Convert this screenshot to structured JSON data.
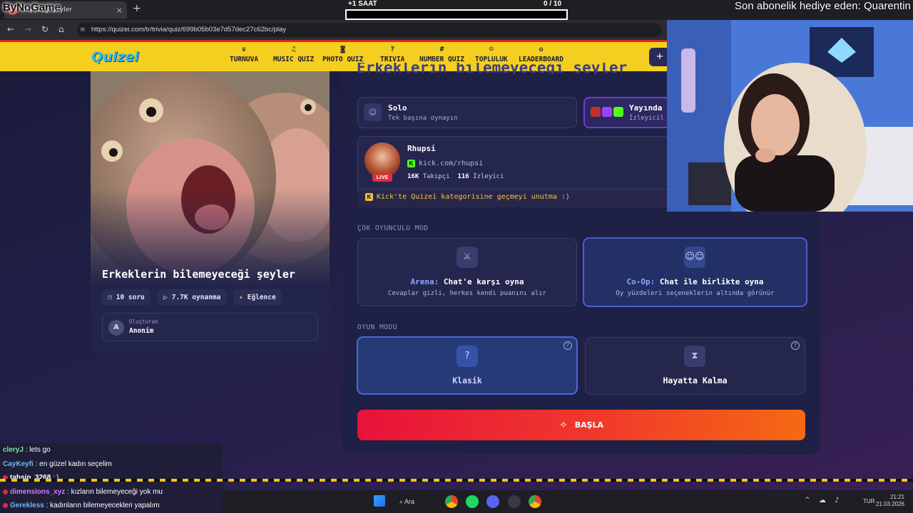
{
  "browser": {
    "tab_title": "neyeceği şeyler",
    "url": "https://quizei.com/tr/trivia/quiz/699b05b03e7d57dec27c62bc/play",
    "new_tab_label": "+",
    "close_tab_label": "×"
  },
  "overlay": {
    "channel_logo_text": "ByNoGame",
    "timer_label": "+1 SAAT",
    "timer_count": "0  / 10",
    "timer_progress": 0,
    "sub_gift_text": "Son abonelik hediye eden: Quarentin"
  },
  "site": {
    "logo": "Quizei",
    "nav": [
      {
        "label": "TURNUVA",
        "icon": "trophy-icon",
        "glyph": "♛"
      },
      {
        "label": "MUSIC QUIZ",
        "icon": "music-icon",
        "glyph": "♫"
      },
      {
        "label": "PHOTO QUIZ",
        "icon": "camera-icon",
        "glyph": "◙"
      },
      {
        "label": "TRIVIA",
        "icon": "question-bubble-icon",
        "glyph": "?"
      },
      {
        "label": "NUMBER QUIZ",
        "icon": "hash-icon",
        "glyph": "#"
      },
      {
        "label": "TOPLULUK",
        "icon": "users-icon",
        "glyph": "☺"
      },
      {
        "label": "LEADERBOARD",
        "icon": "medal-icon",
        "glyph": "✪"
      }
    ],
    "plus_label": "+"
  },
  "quiz": {
    "title": "Erkeklerin bilemeyeceği şeyler",
    "heading": "Erkeklerin bilemeyeceği şeyler",
    "question_count": "10 soru",
    "plays": "7.7K oynanma",
    "category": "Eğlence",
    "creator_role": "Oluşturan",
    "creator_name": "Anonim",
    "creator_initial": "A"
  },
  "modes": {
    "solo_title": "Solo",
    "solo_sub": "Tek başına oynayın",
    "stream_title": "Yayında",
    "stream_sub": "İzleyicil"
  },
  "streamer": {
    "name": "Rhupsi",
    "link": "kick.com/rhupsi",
    "followers": "16K",
    "followers_label": "Takipçi",
    "viewers": "116",
    "viewers_label": "İzleyici",
    "live_label": "LIVE",
    "note": "Kick'te Quizei kategorisine geçmeyi unutma :)",
    "kick_badge": "K"
  },
  "multiplayer": {
    "section_label": "ÇOK OYUNCULU MOD",
    "arena_accent": "Arena:",
    "arena_title": "Chat'e karşı oyna",
    "arena_sub": "Cevaplar gizli, herkes kendi puanını alır",
    "coop_accent": "Co-Op:",
    "coop_title": "Chat ile birlikte oyna",
    "coop_sub": "Oy yüzdeleri seçeneklerin altında görünür"
  },
  "game_mode": {
    "section_label": "OYUN MODU",
    "classic": "Klasik",
    "survival": "Hayatta Kalma",
    "help_glyph": "?"
  },
  "start_button": "BAŞLA",
  "chat": [
    {
      "user": "cleryJ",
      "msg": "lets go",
      "color": "#7fe3a0",
      "badge": false
    },
    {
      "user": "CayKeyfi",
      "msg": "en güzel kadın seçelim",
      "color": "#6fb6ff",
      "badge": false
    },
    {
      "user": "tahsin_3268",
      "msg": "\\",
      "color": "#ffffff",
      "badge": true
    },
    {
      "user": "dimensions_xyz",
      "msg": "kızların bilemeyeceği yok mu",
      "color": "#d07cff",
      "badge": true
    },
    {
      "user": "Gerekless",
      "msg": "kadınların bilemeyecekleri yapalım",
      "color": "#6fb6ff",
      "badge": true
    }
  ],
  "taskbar": {
    "search_label": "Ara",
    "time": "21:21",
    "date": "21.03.2026",
    "lang": "TUR"
  },
  "colors": {
    "header_yellow": "#f5cf1f",
    "accent_blue": "#4a5ec8",
    "start_gradient_start": "#e8123a",
    "start_gradient_end": "#f56a12",
    "kick_green": "#53fc18"
  }
}
